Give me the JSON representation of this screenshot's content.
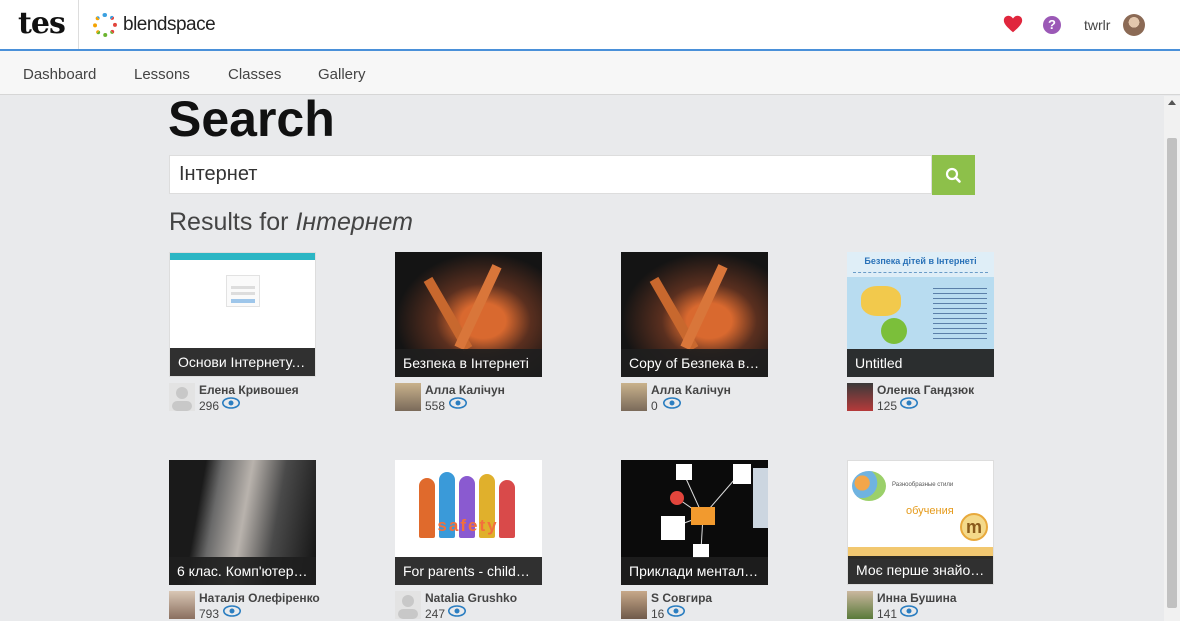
{
  "header": {
    "brand_tes": "tes",
    "brand_name": "blendspace",
    "help_glyph": "?",
    "username": "twrlr",
    "icons": [
      "heart-icon",
      "help-icon",
      "avatar"
    ]
  },
  "nav": {
    "items": [
      {
        "label": "Dashboard"
      },
      {
        "label": "Lessons"
      },
      {
        "label": "Classes"
      },
      {
        "label": "Gallery"
      }
    ]
  },
  "search": {
    "title": "Search",
    "query": "Інтернет",
    "button_icon": "search-icon",
    "results_prefix": "Results for",
    "results_query": "Інтернет"
  },
  "results": [
    {
      "title": "Основи Інтернету. ...",
      "author": "Елена Кривошея",
      "views": "296"
    },
    {
      "title": "Безпека в Інтернеті",
      "author": "Алла Калічун",
      "views": "558"
    },
    {
      "title": "Copy of Безпека в І...",
      "author": "Алла Калічун",
      "views": "0"
    },
    {
      "title": "Untitled",
      "author": "Оленка Гандзюк",
      "views": "125"
    },
    {
      "title": "6 клас. Комп'ютерн...",
      "author": "Наталія Олефіренко",
      "views": "793"
    },
    {
      "title": "For parents - childre...",
      "author": "Natalia Grushko",
      "views": "247"
    },
    {
      "title": "Приклади менталь...",
      "author": "S Совгира",
      "views": "16"
    },
    {
      "title": "Моє перше знайом...",
      "author": "Инна Бушина",
      "views": "141"
    }
  ],
  "thumb_text": {
    "poster_heading": "Безпека дітей в Інтернеті",
    "slide_text": "Разнообразные стили",
    "slide_word": "обучения",
    "kids_word": "safety",
    "mm_logo": "m"
  },
  "colors": {
    "accent_blue": "#4a90d9",
    "search_button": "#8dc04a",
    "heart": "#e0263d",
    "help": "#9b59b6",
    "eye": "#2b7ec1"
  }
}
